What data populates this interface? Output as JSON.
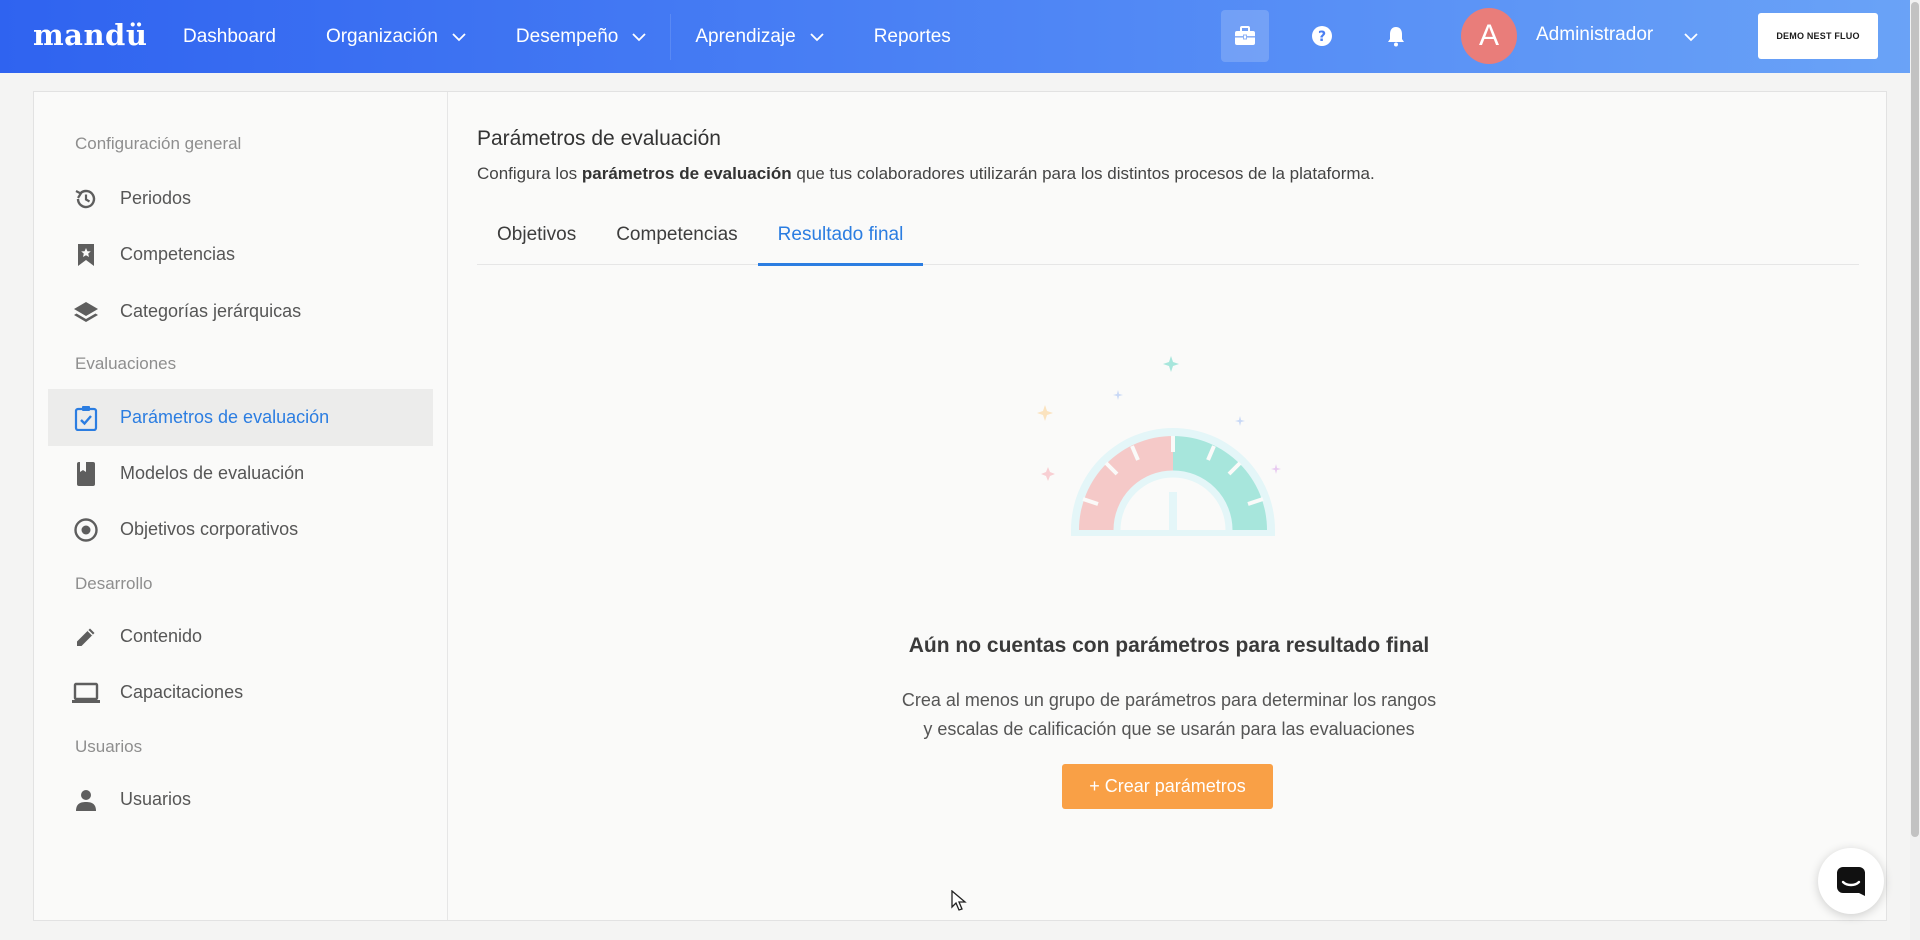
{
  "header": {
    "logo": "mandü",
    "nav": [
      {
        "label": "Dashboard",
        "dropdown": false
      },
      {
        "label": "Organización",
        "dropdown": true
      },
      {
        "label": "Desempeño",
        "dropdown": true
      },
      {
        "label": "Aprendizaje",
        "dropdown": true
      },
      {
        "label": "Reportes",
        "dropdown": false
      }
    ],
    "avatar_initial": "A",
    "user_name": "Administrador",
    "demo_label": "DEMO NEST FLUO",
    "icons": [
      "briefcase-icon",
      "help-icon",
      "bell-icon"
    ]
  },
  "sidebar": {
    "sections": [
      {
        "title": "Configuración general",
        "items": [
          {
            "label": "Periodos",
            "icon": "history-icon"
          },
          {
            "label": "Competencias",
            "icon": "bookmark-icon"
          },
          {
            "label": "Categorías jerárquicas",
            "icon": "layers-icon"
          }
        ]
      },
      {
        "title": "Evaluaciones",
        "items": [
          {
            "label": "Parámetros de evaluación",
            "icon": "clipboard-check-icon",
            "active": true
          },
          {
            "label": "Modelos de evaluación",
            "icon": "book-icon"
          },
          {
            "label": "Objetivos corporativos",
            "icon": "target-icon"
          }
        ]
      },
      {
        "title": "Desarrollo",
        "items": [
          {
            "label": "Contenido",
            "icon": "pencil-icon"
          },
          {
            "label": "Capacitaciones",
            "icon": "laptop-icon"
          }
        ]
      },
      {
        "title": "Usuarios",
        "items": [
          {
            "label": "Usuarios",
            "icon": "person-icon"
          }
        ]
      }
    ]
  },
  "main": {
    "title": "Parámetros de evaluación",
    "desc_pre": "Configura los ",
    "desc_bold": "parámetros de evaluación",
    "desc_post": " que tus colaboradores utilizarán para los distintos procesos de la plataforma.",
    "tabs": [
      {
        "label": "Objetivos"
      },
      {
        "label": "Competencias"
      },
      {
        "label": "Resultado final",
        "active": true
      }
    ],
    "empty_title": "Aún no cuentas con parámetros para resultado final",
    "empty_line1": "Crea al menos un grupo de parámetros para determinar los rangos",
    "empty_line2": "y escalas de calificación que se usarán para las evaluaciones",
    "create_button": "+ Crear parámetros"
  },
  "colors": {
    "accent": "#2b7de1",
    "cta": "#f9a046",
    "gauge_red": "#f5c9c8",
    "gauge_green": "#a7e6dc"
  }
}
